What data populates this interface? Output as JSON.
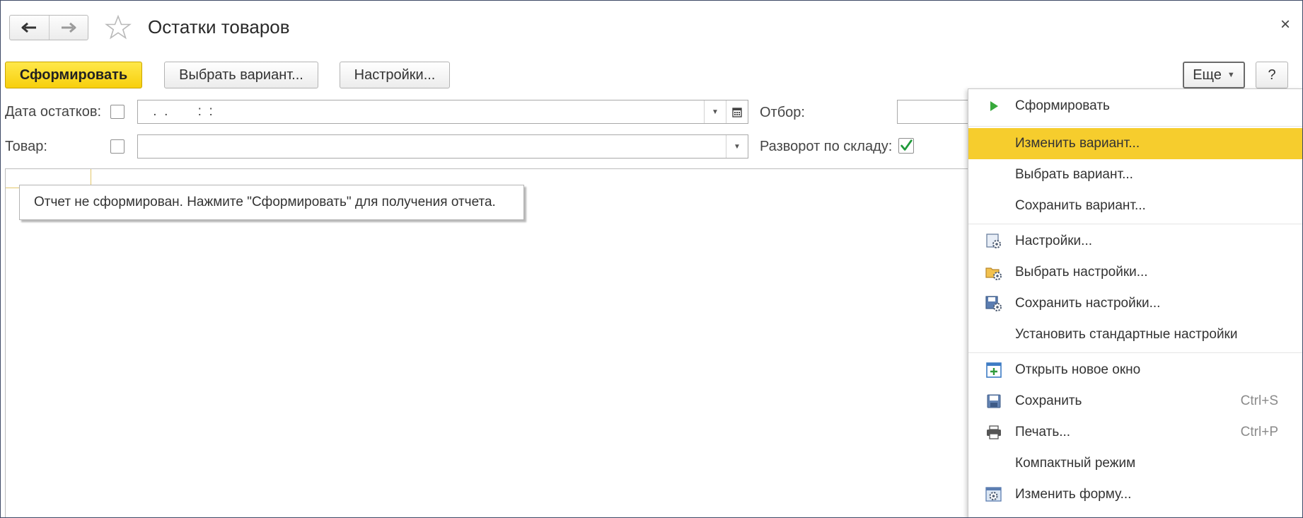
{
  "window": {
    "title": "Остатки товаров",
    "close_glyph": "×"
  },
  "toolbar": {
    "generate_label": "Сформировать",
    "choose_variant_label": "Выбрать вариант...",
    "settings_label": "Настройки...",
    "more_label": "Еще",
    "help_label": "?"
  },
  "filters": {
    "date_label": "Дата остатков:",
    "date_value": " .  .        :  :",
    "product_label": "Товар:",
    "product_value": "",
    "filter_label": "Отбор:",
    "warehouse_label": "Разворот по складу:",
    "warehouse_checked": true
  },
  "report": {
    "message": "Отчет не сформирован. Нажмите \"Сформировать\" для получения отчета."
  },
  "menu": {
    "items": [
      {
        "label": "Сформировать",
        "shortcut": "",
        "icon": "play-icon",
        "highlighted": false
      },
      {
        "label": "Изменить вариант...",
        "shortcut": "",
        "icon": "",
        "highlighted": true
      },
      {
        "label": "Выбрать вариант...",
        "shortcut": "",
        "icon": "",
        "highlighted": false
      },
      {
        "label": "Сохранить вариант...",
        "shortcut": "",
        "icon": "",
        "highlighted": false
      },
      {
        "label": "Настройки...",
        "shortcut": "",
        "icon": "settings-icon",
        "highlighted": false
      },
      {
        "label": "Выбрать настройки...",
        "shortcut": "",
        "icon": "folder-settings-icon",
        "highlighted": false
      },
      {
        "label": "Сохранить настройки...",
        "shortcut": "",
        "icon": "save-settings-icon",
        "highlighted": false
      },
      {
        "label": "Установить стандартные настройки",
        "shortcut": "",
        "icon": "",
        "highlighted": false
      },
      {
        "label": "Открыть новое окно",
        "shortcut": "",
        "icon": "new-window-icon",
        "highlighted": false
      },
      {
        "label": "Сохранить",
        "shortcut": "Ctrl+S",
        "icon": "floppy-icon",
        "highlighted": false
      },
      {
        "label": "Печать...",
        "shortcut": "Ctrl+P",
        "icon": "printer-icon",
        "highlighted": false
      },
      {
        "label": "Компактный режим",
        "shortcut": "",
        "icon": "",
        "highlighted": false
      },
      {
        "label": "Изменить форму...",
        "shortcut": "",
        "icon": "form-settings-icon",
        "highlighted": false
      }
    ]
  },
  "colors": {
    "primary_button": "#f7cf0c",
    "menu_highlight": "#f6cd2d",
    "check_green": "#1f9a3a",
    "frame_border": "#3f4a66"
  }
}
